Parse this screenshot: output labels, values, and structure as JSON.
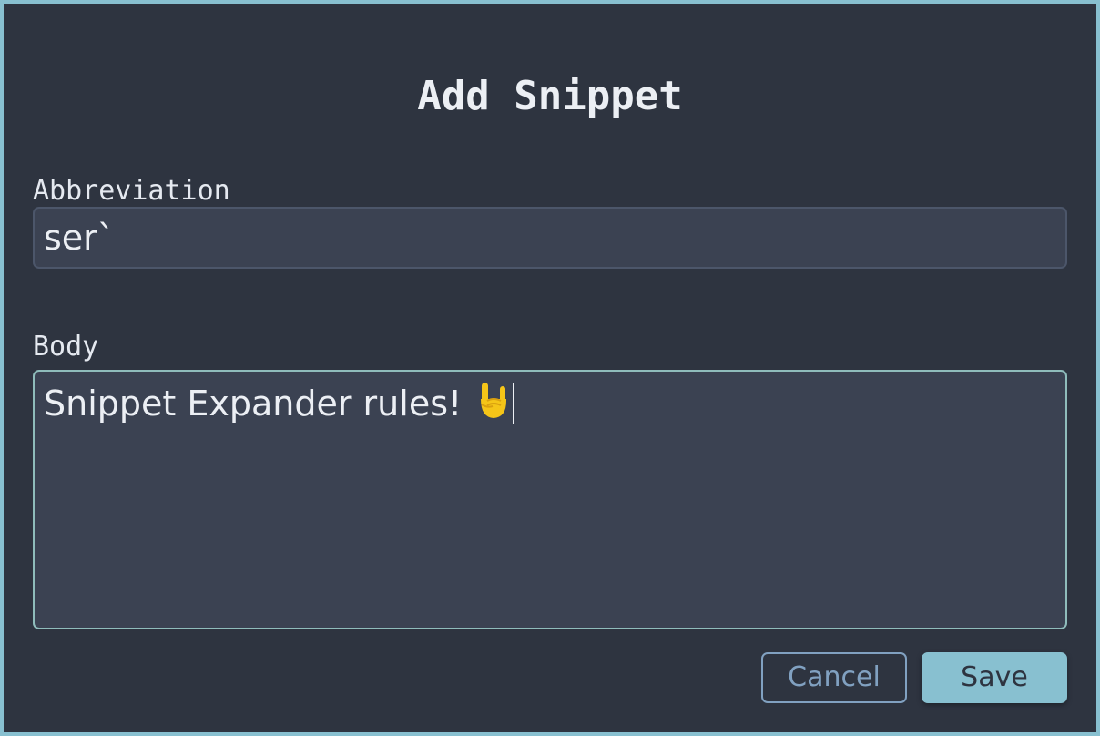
{
  "dialog": {
    "title": "Add Snippet"
  },
  "abbreviation": {
    "label": "Abbreviation",
    "value": "ser`"
  },
  "body": {
    "label": "Body",
    "value": "Snippet Expander rules!",
    "emoji_icon": "sign-of-the-horns-icon"
  },
  "buttons": {
    "cancel_label": "Cancel",
    "save_label": "Save"
  },
  "colors": {
    "background": "#2e3440",
    "field": "#3b4252",
    "accent": "#88c0d0",
    "focus_border": "#8fbcbb",
    "text": "#eceff4"
  }
}
